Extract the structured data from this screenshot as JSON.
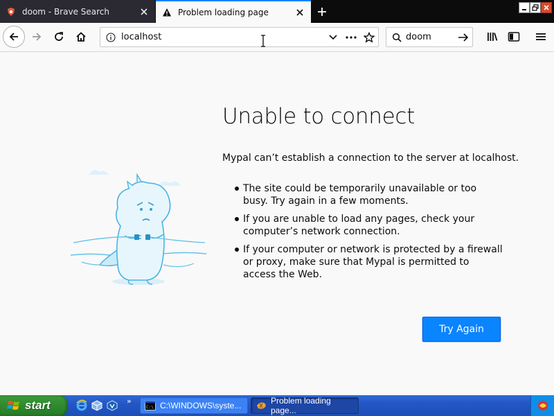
{
  "tabs": [
    {
      "label": "doom - Brave Search",
      "favicon": "brave-lion-icon",
      "active": false
    },
    {
      "label": "Problem loading page",
      "favicon": "warning-icon",
      "active": true
    }
  ],
  "navbar": {
    "url": "localhost",
    "search_value": "doom"
  },
  "error": {
    "title": "Unable to connect",
    "description": "Mypal can’t establish a connection to the server at localhost.",
    "bullets": [
      "The site could be temporarily unavailable or too busy. Try again in a few moments.",
      "If you are unable to load any pages, check your computer’s network connection.",
      "If your computer or network is protected by a firewall or proxy, make sure that Mypal is permitted to access the Web."
    ],
    "retry_label": "Try Again"
  },
  "taskbar": {
    "start_label": "start",
    "tasks": [
      {
        "label": "C:\\WINDOWS\\syste...",
        "icon": "cmd-icon"
      },
      {
        "label": "Problem loading page...",
        "icon": "mypal-icon"
      }
    ]
  },
  "colors": {
    "accent": "#0a84ff",
    "tab_strip": "#0c0c0d",
    "content_bg": "#f9f9fa"
  }
}
